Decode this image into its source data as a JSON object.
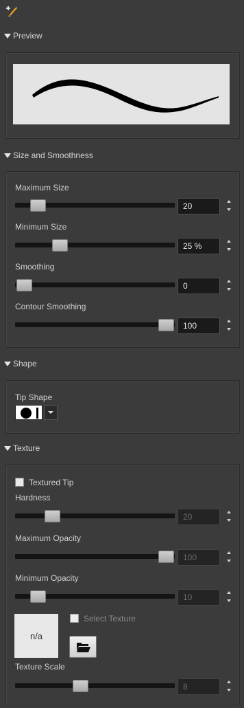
{
  "tool_icon": "brush-plus-icon",
  "sections": {
    "preview": "Preview",
    "size_smoothness": "Size and Smoothness",
    "shape": "Shape",
    "texture": "Texture"
  },
  "size": {
    "max_size": {
      "label": "Maximum Size",
      "value": "20",
      "level": 0.1
    },
    "min_size": {
      "label": "Minimum Size",
      "value": "25 %",
      "level": 0.25
    },
    "smoothing": {
      "label": "Smoothing",
      "value": "0",
      "level": 0.0
    },
    "contour": {
      "label": "Contour Smoothing",
      "value": "100",
      "level": 1.0
    }
  },
  "shape": {
    "tip_label": "Tip Shape",
    "tip_icon": "round-tip-icon"
  },
  "texture": {
    "textured_tip": "Textured Tip",
    "textured_tip_checked": false,
    "hardness": {
      "label": "Hardness",
      "value": "20",
      "level": 0.2
    },
    "max_opacity": {
      "label": "Maximum Opacity",
      "value": "100",
      "level": 1.0
    },
    "min_opacity": {
      "label": "Minimum Opacity",
      "value": "10",
      "level": 0.1
    },
    "thumbnail": "n/a",
    "select_texture": "Select Texture",
    "select_texture_checked": false,
    "folder_icon": "open-folder-icon",
    "scale": {
      "label": "Texture Scale",
      "value": "8",
      "level": 0.4
    }
  }
}
